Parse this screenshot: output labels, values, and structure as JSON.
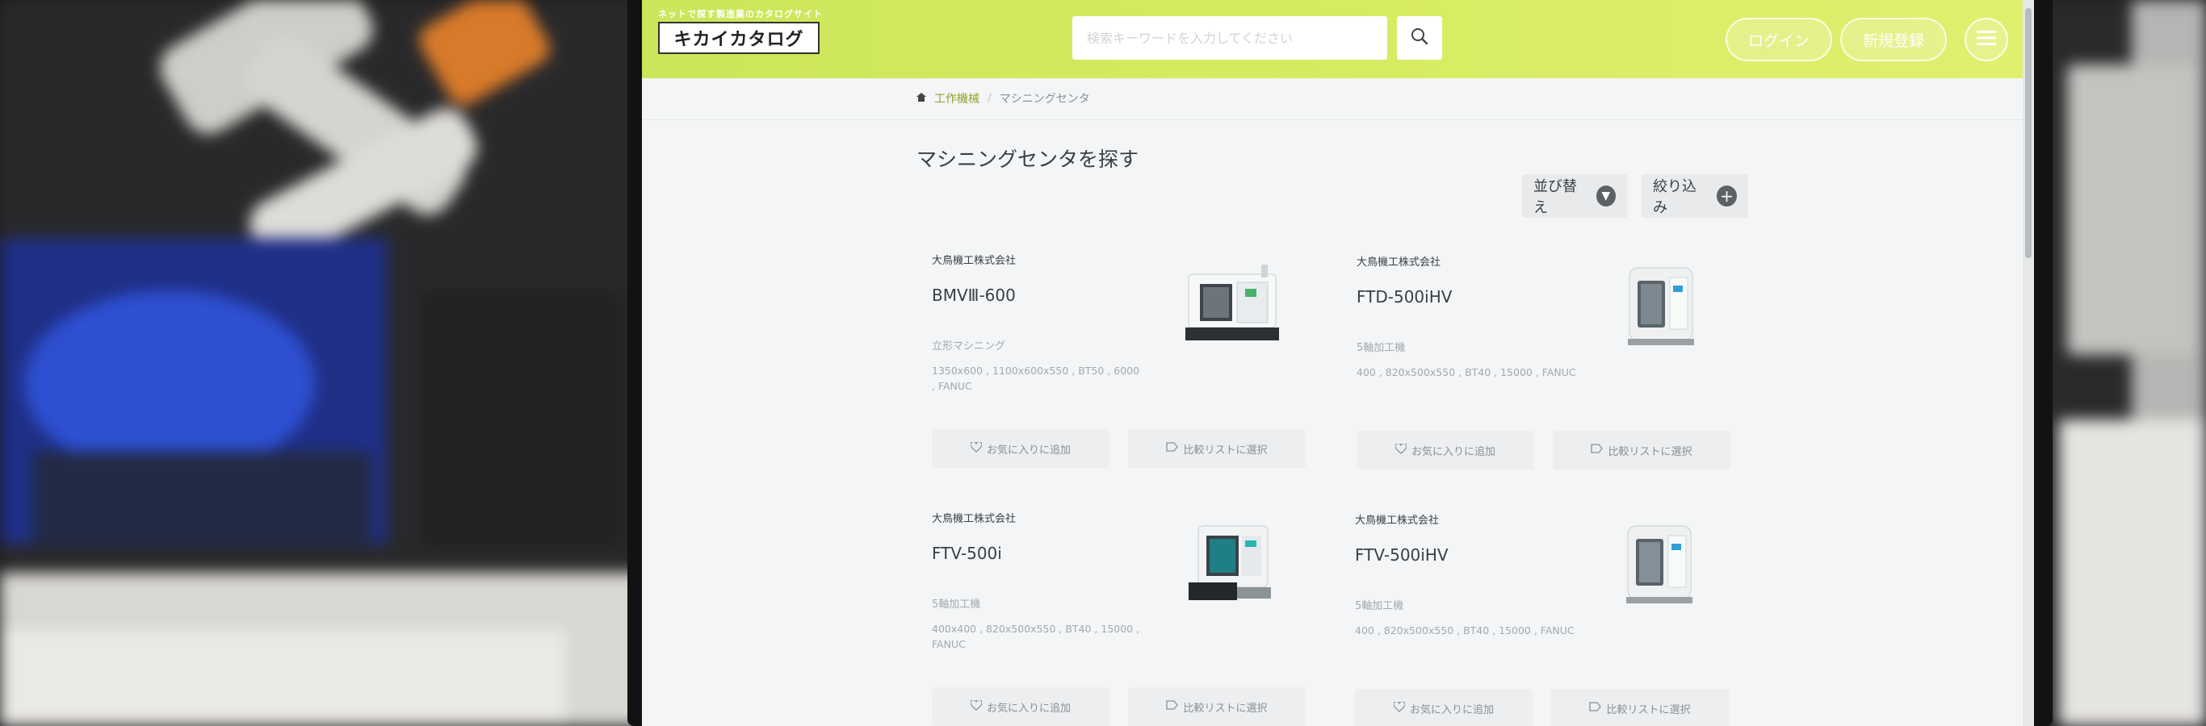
{
  "header": {
    "tagline": "ネットで探す製造業のカタログサイト",
    "logo_text": "キカイカタログ",
    "search_placeholder": "検索キーワードを入力してください",
    "login_label": "ログイン",
    "register_label": "新規登録"
  },
  "breadcrumb": {
    "home_label": "工作機械",
    "current_label": "マシニングセンタ"
  },
  "page": {
    "title": "マシニングセンタを探す",
    "sort_label": "並び替え",
    "filter_label": "絞り込み"
  },
  "card_actions": {
    "favorite_label": "お気に入りに追加",
    "compare_label": "比較リストに選択"
  },
  "products": [
    {
      "maker": "大鳥機工株式会社",
      "model": "BMVⅢ-600",
      "category": "立形マシニング",
      "specs": "1350x600 , 1100x600x550 , BT50 , 6000 , FANUC"
    },
    {
      "maker": "大鳥機工株式会社",
      "model": "FTD-500iHV",
      "category": "5軸加工機",
      "specs": "400 , 820x500x550 , BT40 , 15000 , FANUC"
    },
    {
      "maker": "大鳥機工株式会社",
      "model": "FTV-500i",
      "category": "5軸加工機",
      "specs": "400x400 , 820x500x550 , BT40 , 15000 , FANUC"
    },
    {
      "maker": "大鳥機工株式会社",
      "model": "FTV-500iHV",
      "category": "5軸加工機",
      "specs": "400 , 820x500x550 , BT40 , 15000 , FANUC"
    }
  ],
  "colors": {
    "header_green": "#cbe65a",
    "page_bg": "#f3f5f6",
    "button_grey": "#e8eaec"
  }
}
